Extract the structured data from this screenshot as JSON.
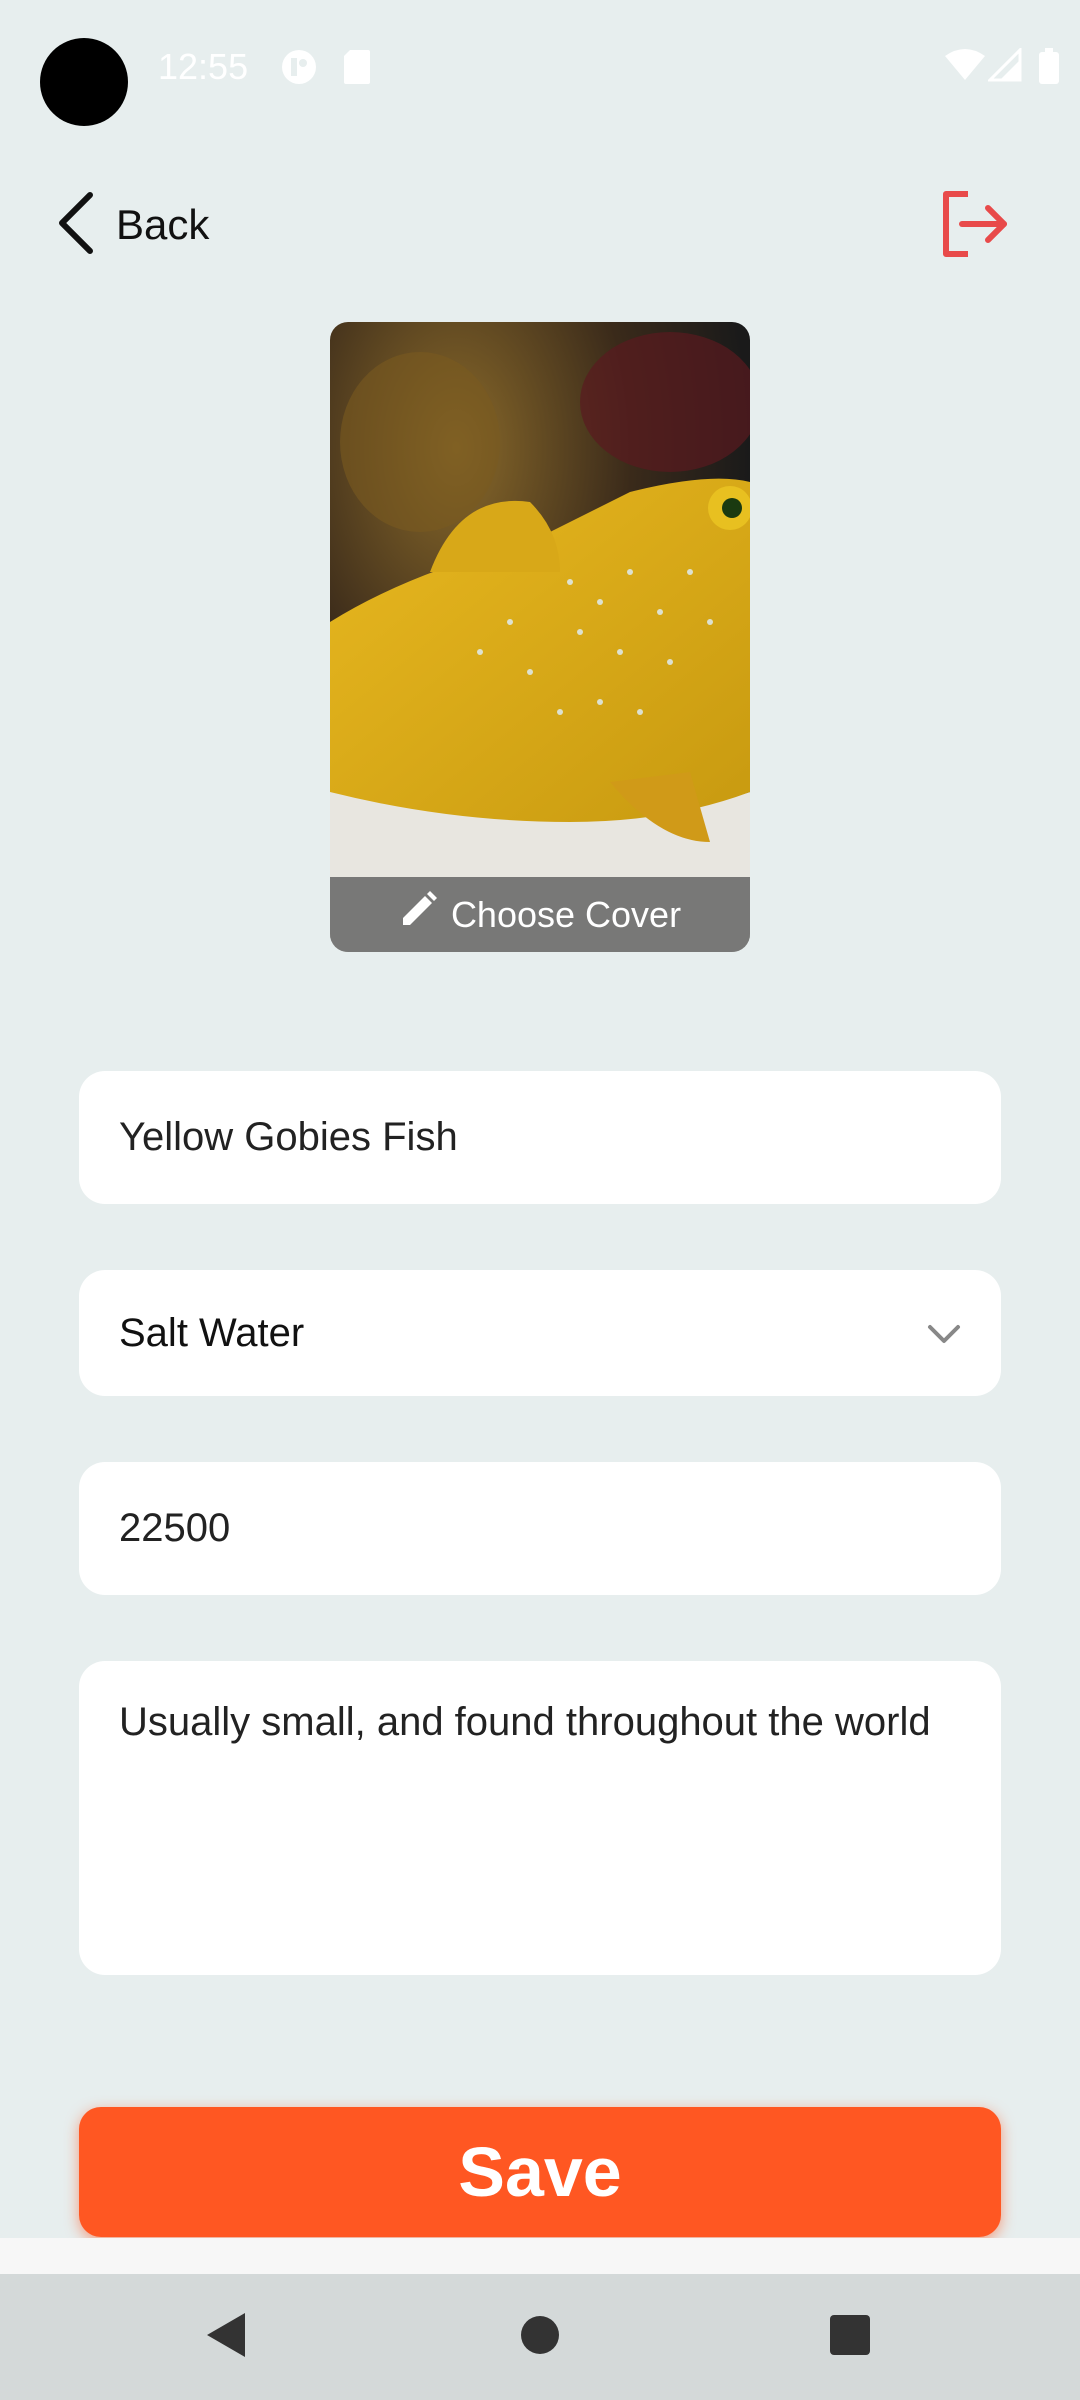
{
  "status_bar": {
    "time": "12:55",
    "icons": [
      "notification-icon",
      "sd-card-icon",
      "wifi-icon",
      "signal-icon",
      "battery-icon"
    ]
  },
  "top_bar": {
    "back_label": "Back",
    "back_icon": "chevron-left-icon",
    "logout_icon": "logout-icon",
    "accent_color": "#e84a4a"
  },
  "cover": {
    "overlay_label": "Choose Cover",
    "overlay_icon": "pencil-icon"
  },
  "form": {
    "name_value": "Yellow Gobies Fish",
    "type_selected": "Salt Water",
    "price_value": "22500",
    "description_value": "Usually small, and found throughout the world"
  },
  "save_label": "Save",
  "colors": {
    "background": "#e7eeee",
    "save_button": "#ff5722",
    "field_background": "#ffffff"
  },
  "nav_bar": {
    "buttons": [
      "back-triangle-icon",
      "home-circle-icon",
      "recents-square-icon"
    ]
  }
}
